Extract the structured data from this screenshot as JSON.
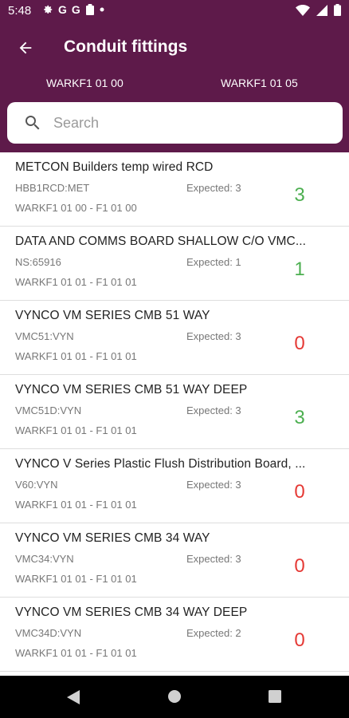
{
  "status_bar": {
    "time": "5:48",
    "left_icons": [
      "gear-icon",
      "G",
      "G",
      "clipboard-icon",
      "dot"
    ],
    "right_icons": [
      "wifi-icon",
      "signal-icon",
      "battery-icon"
    ]
  },
  "app_bar": {
    "title": "Conduit fittings",
    "back_icon": "arrow-back-icon"
  },
  "range": {
    "from": "WARKF1 01 00",
    "to": "WARKF1 01 05"
  },
  "search": {
    "placeholder": "Search",
    "value": ""
  },
  "items": [
    {
      "name": "METCON Builders temp wired RCD",
      "code": "HBB1RCD:MET",
      "expected": "Expected: 3",
      "location": "WARKF1 01 00 - F1 01 00",
      "count": "3",
      "status": "ok"
    },
    {
      "name": "DATA AND COMMS BOARD SHALLOW C/O VMC...",
      "code": "NS:65916",
      "expected": "Expected: 1",
      "location": "WARKF1 01 01 - F1 01 01",
      "count": "1",
      "status": "ok"
    },
    {
      "name": "VYNCO VM SERIES CMB 51 WAY",
      "code": "VMC51:VYN",
      "expected": "Expected: 3",
      "location": "WARKF1 01 01 - F1 01 01",
      "count": "0",
      "status": "zero"
    },
    {
      "name": "VYNCO VM SERIES CMB 51 WAY DEEP",
      "code": "VMC51D:VYN",
      "expected": "Expected: 3",
      "location": "WARKF1 01 01 - F1 01 01",
      "count": "3",
      "status": "ok"
    },
    {
      "name": "VYNCO V Series Plastic Flush Distribution Board, ...",
      "code": "V60:VYN",
      "expected": "Expected: 3",
      "location": "WARKF1 01 01 - F1 01 01",
      "count": "0",
      "status": "zero"
    },
    {
      "name": "VYNCO VM SERIES CMB 34 WAY",
      "code": "VMC34:VYN",
      "expected": "Expected: 3",
      "location": "WARKF1 01 01 - F1 01 01",
      "count": "0",
      "status": "zero"
    },
    {
      "name": "VYNCO VM SERIES CMB 34 WAY DEEP",
      "code": "VMC34D:VYN",
      "expected": "Expected: 2",
      "location": "WARKF1 01 01 - F1 01 01",
      "count": "0",
      "status": "zero"
    }
  ],
  "colors": {
    "header": "#5e1a4a",
    "count_ok": "#4caf50",
    "count_zero": "#e53935"
  },
  "nav_bar": {
    "icons": [
      "nav-back-icon",
      "nav-home-icon",
      "nav-recents-icon"
    ]
  }
}
